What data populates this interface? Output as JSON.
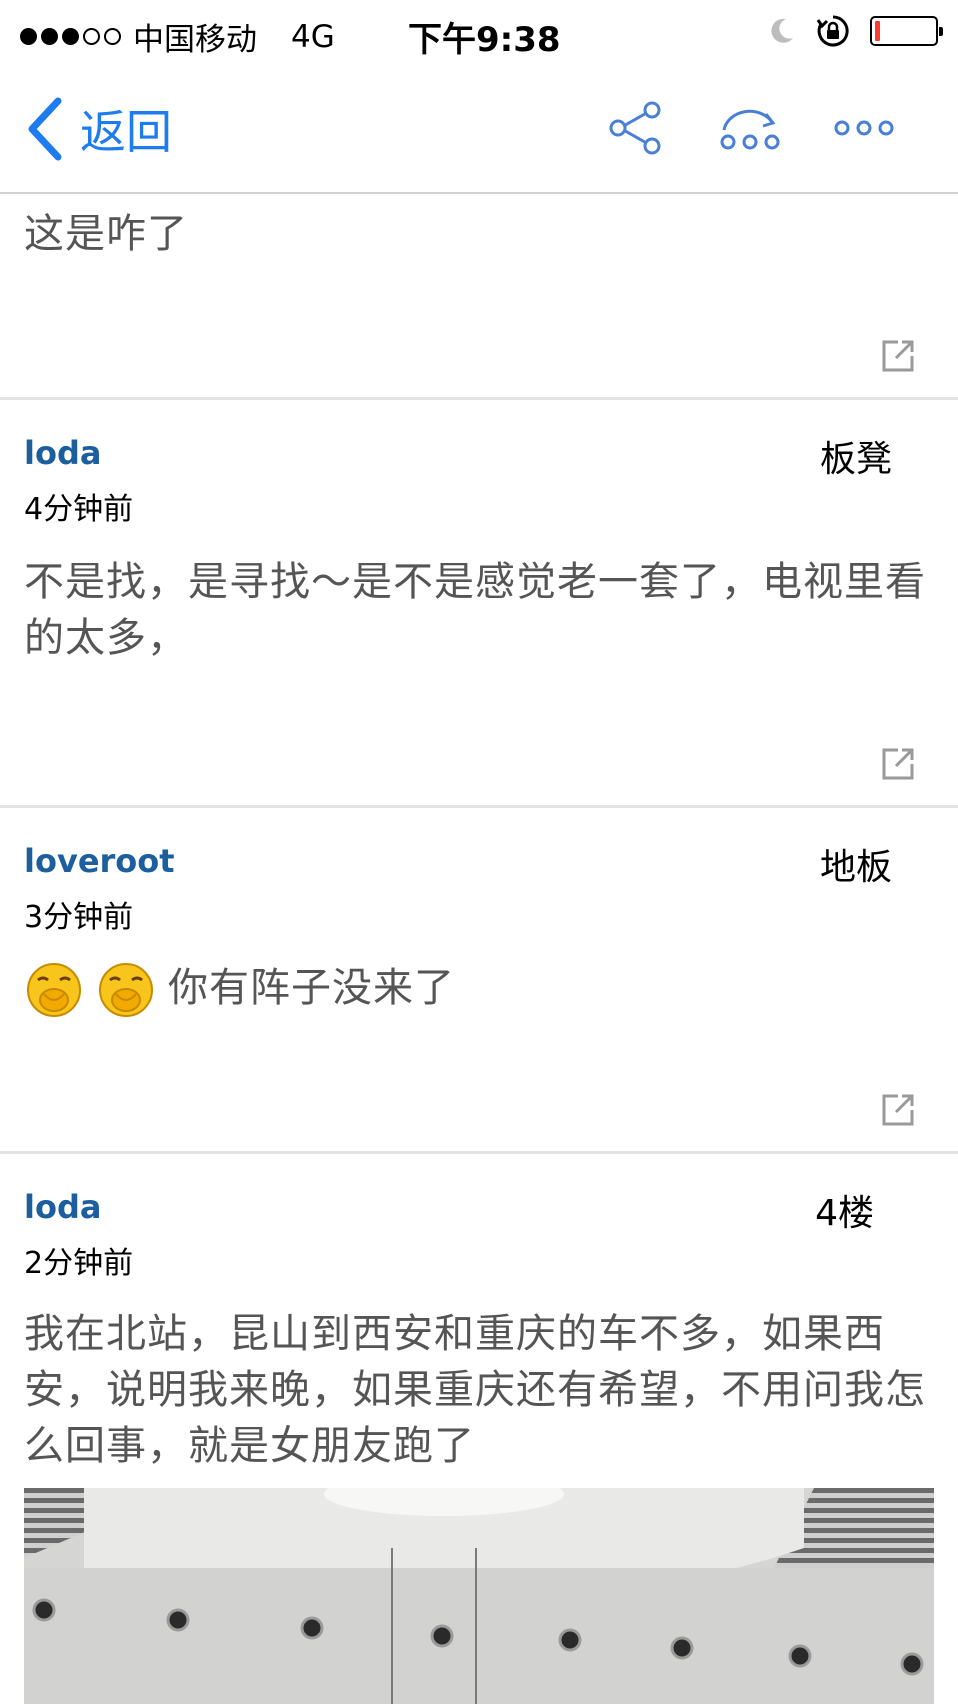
{
  "status_bar": {
    "carrier": "中国移动",
    "network": "4G",
    "time": "下午9:38"
  },
  "nav": {
    "back_label": "返回",
    "icons": [
      "share-icon",
      "reply-icon",
      "more-icon"
    ],
    "accent_color": "#1e7cf1"
  },
  "posts": [
    {
      "body": "这是咋了"
    },
    {
      "author": "loda",
      "floor": "板凳",
      "time": "4分钟前",
      "body": "不是找，是寻找～是不是感觉老一套了，电视里看的太多，"
    },
    {
      "author": "loveroot",
      "floor": "地板",
      "time": "3分钟前",
      "body": "你有阵子没来了"
    },
    {
      "author": "loda",
      "floor": "4楼",
      "time": "2分钟前",
      "body": "我在北站，昆山到西安和重庆的车不多，如果西安，说明我来晚，如果重庆还有希望，不用问我怎么回事，就是女朋友跑了"
    }
  ],
  "colors": {
    "author": "#1c5e9e",
    "body_text": "#555555",
    "battery_low": "#ff3b30"
  }
}
